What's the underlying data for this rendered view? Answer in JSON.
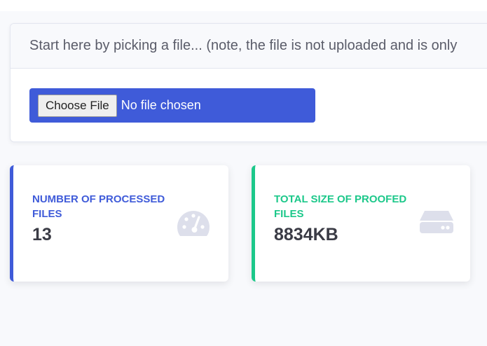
{
  "upload": {
    "header_text": "Start here by picking a file... (note, the file is not uploaded and is only",
    "button_label": "Choose File",
    "status_text": "No file chosen"
  },
  "stats": [
    {
      "label": "Number of processed files",
      "value": "13",
      "icon": "tachometer-icon",
      "color": "#3f5bd9"
    },
    {
      "label": "Total size of proofed files",
      "value": "8834KB",
      "icon": "hard-drive-icon",
      "color": "#1cc88a"
    }
  ]
}
